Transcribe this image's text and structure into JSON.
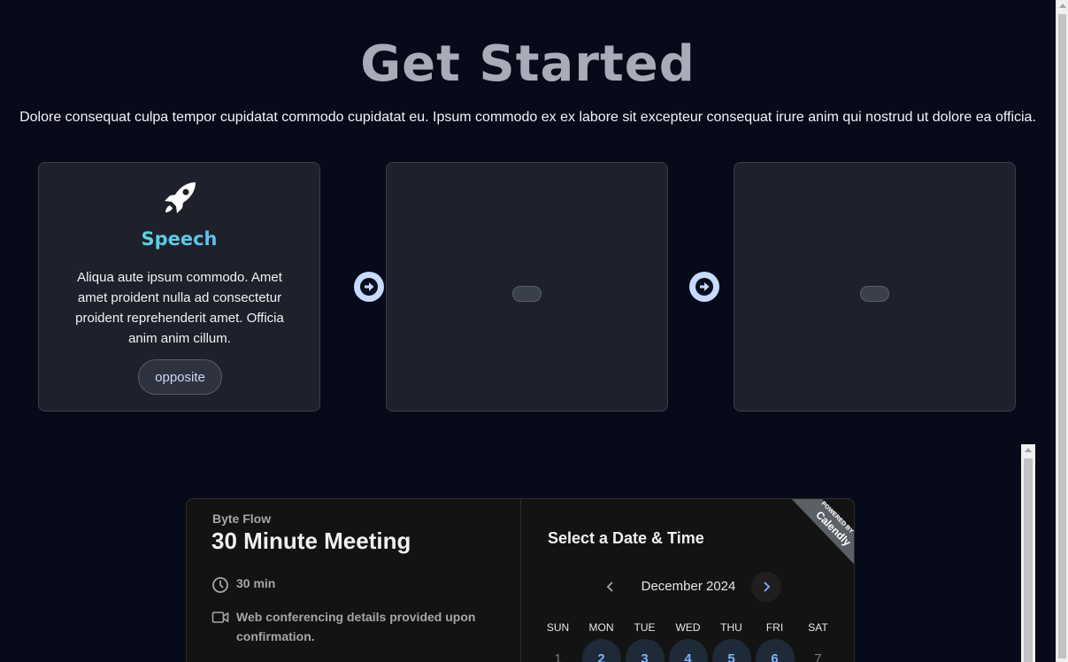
{
  "hero": {
    "title": "Get Started",
    "subtitle": "Dolore consequat culpa tempor cupidatat commodo cupidatat eu. Ipsum commodo ex ex labore sit excepteur consequat irure anim qui nostrud ut dolore ea officia."
  },
  "cards": [
    {
      "icon": "rocket-icon",
      "title": "Speech",
      "description": "Aliqua aute ipsum commodo. Amet amet proident nulla ad consectetur proident reprehenderit amet. Officia anim anim cillum.",
      "button_label": "opposite"
    },
    {
      "placeholder": true
    },
    {
      "placeholder": true
    }
  ],
  "scheduler": {
    "organization": "Byte Flow",
    "event_name": "30 Minute Meeting",
    "duration": "30 min",
    "conferencing": "Web conferencing details provided upon confirmation.",
    "select_title": "Select a Date & Time",
    "month": "December 2024",
    "ribbon_top": "POWERED BY",
    "ribbon_brand": "Calendly",
    "weekdays": [
      "SUN",
      "MON",
      "TUE",
      "WED",
      "THU",
      "FRI",
      "SAT"
    ],
    "first_week": [
      {
        "day": "1",
        "available": false
      },
      {
        "day": "2",
        "available": true
      },
      {
        "day": "3",
        "available": true
      },
      {
        "day": "4",
        "available": true
      },
      {
        "day": "5",
        "available": true
      },
      {
        "day": "6",
        "available": true
      },
      {
        "day": "7",
        "available": false
      }
    ]
  },
  "colors": {
    "background": "#070b19",
    "card": "#1e202b",
    "accent_gradient_start": "#5eead4",
    "accent_gradient_end": "#60a5fa",
    "arrow_circle": "#c7dbff",
    "available_day": "#7fb1ff"
  }
}
